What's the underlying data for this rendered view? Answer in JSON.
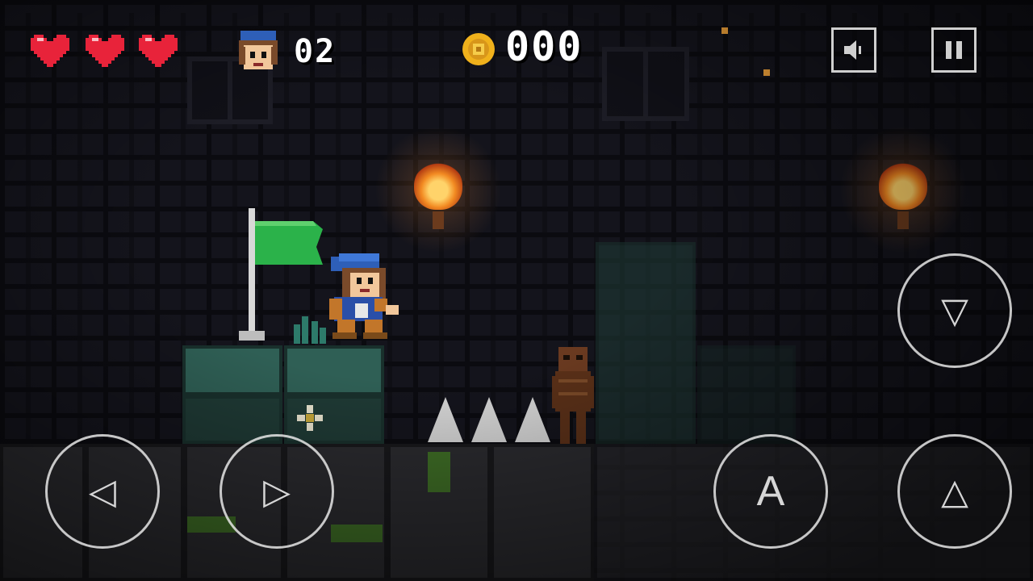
{
  "hud": {
    "hearts": 3,
    "lives_label": "02",
    "coins_label": "000"
  },
  "controls": {
    "left_glyph": "◁",
    "right_glyph": "▷",
    "down_glyph": "▽",
    "jump_glyph": "△",
    "attack_label": "A"
  },
  "colors": {
    "heart": "#e8233a",
    "coin": "#f0b11c",
    "flag": "#2bb24a",
    "torch": "#f28a22",
    "moss": "#2f5f55"
  }
}
